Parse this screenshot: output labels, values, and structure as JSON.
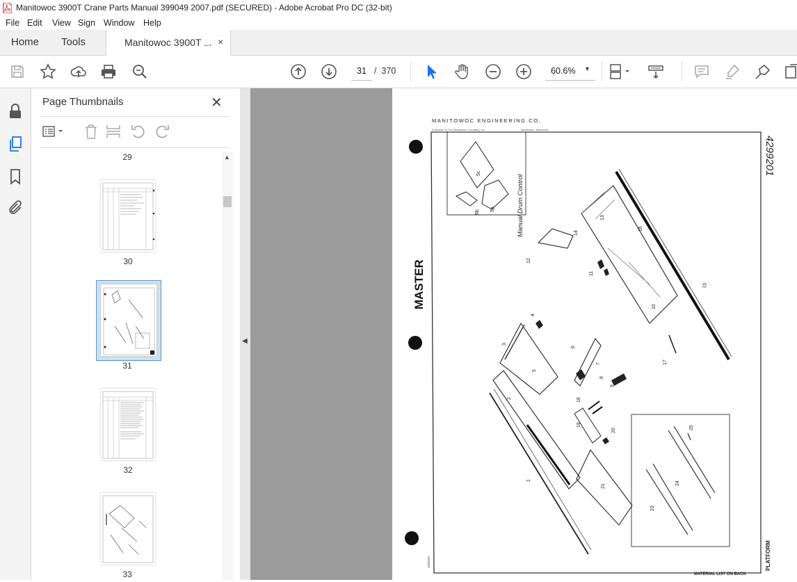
{
  "window": {
    "title": "Manitowoc 3900T Crane Parts Manual 399049 2007.pdf (SECURED) - Adobe Acrobat Pro DC (32-bit)"
  },
  "menu": [
    "File",
    "Edit",
    "View",
    "Sign",
    "Window",
    "Help"
  ],
  "tabs": {
    "home": "Home",
    "tools": "Tools",
    "document": "Manitowoc 3900T ...",
    "close_glyph": "×"
  },
  "toolbar": {
    "current_page": "31",
    "page_separator": "/",
    "total_pages": "370",
    "zoom": "60.6%"
  },
  "panel": {
    "title": "Page Thumbnails",
    "close_glyph": "✕",
    "thumbnails": [
      {
        "label": "29"
      },
      {
        "label": "30"
      },
      {
        "label": "31",
        "selected": true
      },
      {
        "label": "32"
      },
      {
        "label": "33"
      }
    ]
  },
  "document_page": {
    "header": "MANITOWOC ENGINEERING CO.",
    "subheader_left": "A Division of The Manitowoc Company, Inc.",
    "subheader_right": "Manitowoc, Wisconsin",
    "drawing_number": "4299201",
    "stamp": "MASTER",
    "inset_title": "Manual Drum Control",
    "footer_note": "MATERIAL LIST ON BACK",
    "footer_title": "PLATFORM",
    "corner_number": "4299201",
    "callouts": [
      "1",
      "2",
      "3",
      "4",
      "5",
      "5a",
      "5b",
      "5c",
      "6",
      "7",
      "8",
      "9",
      "10",
      "11",
      "12",
      "13",
      "14",
      "15",
      "16",
      "17",
      "18",
      "19",
      "20",
      "21",
      "23",
      "24",
      "25"
    ]
  },
  "colors": {
    "acrobat_red": "#e41f1f",
    "selection_blue": "#5b95c4",
    "viewer_gray": "#9b9b9b",
    "cursor_blue": "#1a73e8"
  }
}
